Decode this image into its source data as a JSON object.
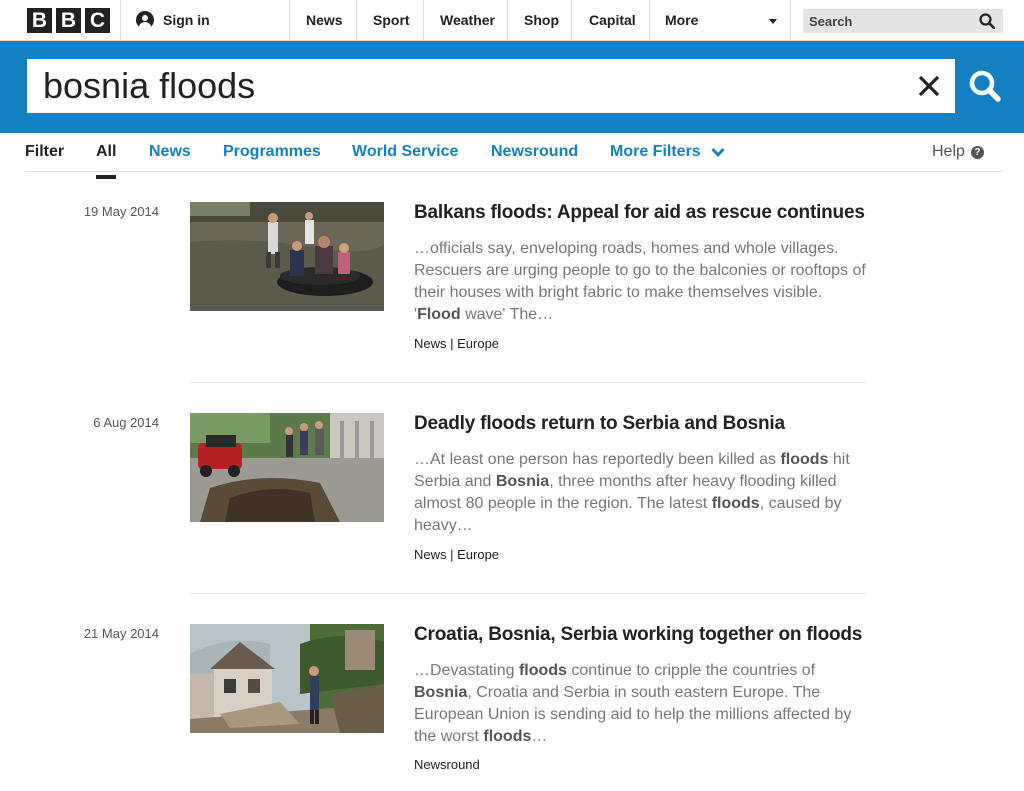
{
  "header": {
    "logo_letters": [
      "B",
      "B",
      "C"
    ],
    "sign_in_label": "Sign in",
    "nav_items": [
      "News",
      "Sport",
      "Weather",
      "Shop",
      "Capital",
      "More"
    ],
    "search_placeholder": "Search"
  },
  "search": {
    "query": "bosnia floods"
  },
  "filters": {
    "label": "Filter",
    "tabs": [
      "All",
      "News",
      "Programmes",
      "World Service",
      "Newsround",
      "More Filters"
    ],
    "active_tab": "All",
    "help_label": "Help",
    "help_icon_glyph": "?"
  },
  "colors": {
    "accent": "#1380c1",
    "text": "#222222",
    "snippet": "#777777"
  },
  "results": [
    {
      "date": "19 May 2014",
      "title": "Balkans floods: Appeal for aid as rescue continues",
      "snippet": [
        {
          "t": "…officials say, enveloping roads, homes and whole villages. Rescuers are urging people to go to the balconies or rooftops of their houses with bright fabric to make themselves visible. '"
        },
        {
          "t": "Flood",
          "b": true
        },
        {
          "t": "wave' The…"
        }
      ],
      "meta": "News | Europe",
      "thumbnail": "people-in-rubber-dinghy-on-floodwater"
    },
    {
      "date": "6 Aug 2014",
      "title": "Deadly floods return to Serbia and Bosnia",
      "snippet": [
        {
          "t": "…At least one person has reportedly been killed as"
        },
        {
          "t": "floods",
          "b": true
        },
        {
          "t": "hit Serbia and"
        },
        {
          "t": "Bosnia",
          "b": true
        },
        {
          "t": ", three months after heavy flooding killed almost 80 people in the region. The latest"
        },
        {
          "t": "floods",
          "b": true
        },
        {
          "t": ", caused by heavy…"
        }
      ],
      "meta": "News | Europe",
      "thumbnail": "red-car-beside-collapsed-road"
    },
    {
      "date": "21 May 2014",
      "title": "Croatia, Bosnia, Serbia working together on floods",
      "snippet": [
        {
          "t": "…Devastating"
        },
        {
          "t": "floods",
          "b": true
        },
        {
          "t": "continue to cripple the countries of"
        },
        {
          "t": "Bosnia",
          "b": true
        },
        {
          "t": ", Croatia and Serbia in south eastern Europe. The European Union is sending aid to help the millions affected by the worst"
        },
        {
          "t": "floods",
          "b": true
        },
        {
          "t": "…"
        }
      ],
      "meta": "Newsround",
      "thumbnail": "damaged-house-after-landslide"
    }
  ]
}
